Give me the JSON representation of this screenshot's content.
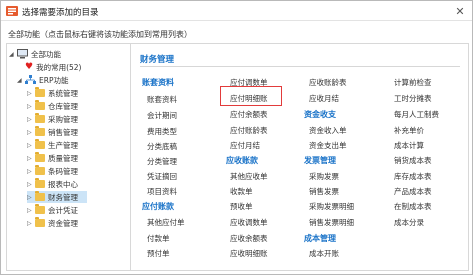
{
  "window": {
    "title": "选择需要添加的目录"
  },
  "hint": "全部功能（点击鼠标右键将该功能添加到常用列表）",
  "tree": {
    "root": "全部功能",
    "favorites": "我的常用(52)",
    "erp": "ERP功能",
    "modules": [
      "系统管理",
      "仓库管理",
      "采购管理",
      "销售管理",
      "生产管理",
      "质量管理",
      "条码管理",
      "报表中心",
      "财务管理",
      "会计凭证",
      "资金管理"
    ],
    "selected": "财务管理"
  },
  "content": {
    "title": "财务管理",
    "col1": {
      "group1": "账套资料",
      "group1_items": [
        "账套资料",
        "会计期间",
        "费用类型",
        "分类底稿",
        "分类管理",
        "凭证摘回",
        "项目资料"
      ],
      "group2": "应付账款",
      "group2_items": [
        "其他应付单",
        "付款单",
        "预付单"
      ]
    },
    "col2": {
      "items_top": [
        "应付调数单",
        "应付明细账",
        "应付余额表",
        "应付账龄表",
        "应付月结"
      ],
      "group": "应收账款",
      "items_bottom": [
        "其他应收单",
        "收款单",
        "预收单",
        "应收调数单",
        "应收余额表",
        "应收明细账"
      ]
    },
    "col3": {
      "items_top": [
        "应收账龄表",
        "应收月结"
      ],
      "group1": "资金收支",
      "group1_items": [
        "资金收入单",
        "资金支出单"
      ],
      "group2": "发票管理",
      "group2_items": [
        "采购发票",
        "销售发票",
        "采购发票明细",
        "销售发票明细"
      ],
      "group3": "成本管理",
      "group3_items": [
        "成本开账"
      ]
    },
    "col4": {
      "items": [
        "计算前检查",
        "工时分摊表",
        "每月人工制费",
        "补充单价",
        "成本计算",
        "销货成本表",
        "库存成本表",
        "产品成本表",
        "在制成本表",
        "成本分录"
      ]
    }
  },
  "colors": {
    "accent": "#1a73c8",
    "highlight": "#e23b3b",
    "selection": "#cce4f7"
  }
}
